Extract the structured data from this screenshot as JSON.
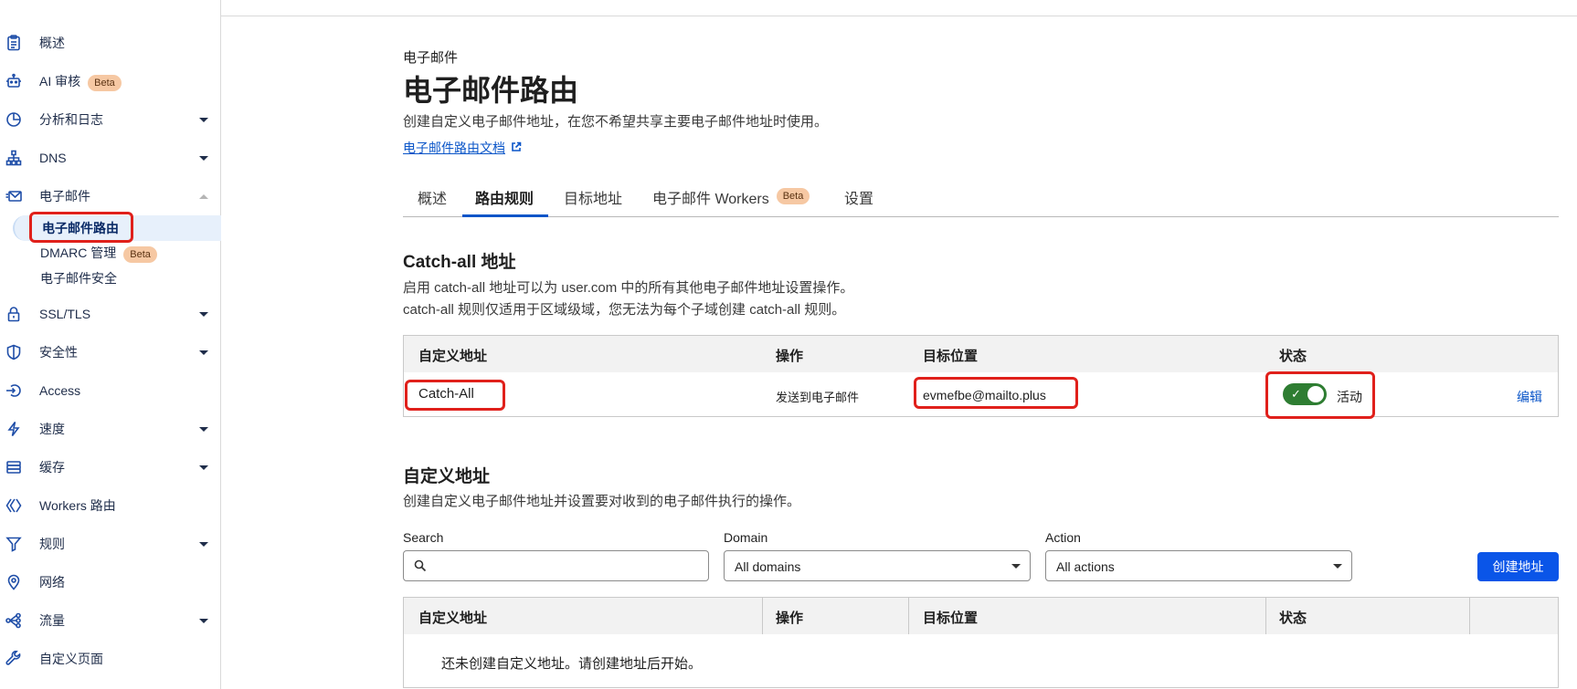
{
  "sidebar": {
    "items": [
      {
        "label": "概述",
        "icon": "clipboard-icon",
        "caret": "none"
      },
      {
        "label": "AI 审核",
        "icon": "robot-icon",
        "caret": "none",
        "badge": "Beta"
      },
      {
        "label": "分析和日志",
        "icon": "chart-pie-icon",
        "caret": "down"
      },
      {
        "label": "DNS",
        "icon": "network-tree-icon",
        "caret": "down"
      },
      {
        "label": "电子邮件",
        "icon": "mail-icon",
        "caret": "up"
      },
      {
        "label": "SSL/TLS",
        "icon": "lock-icon",
        "caret": "down"
      },
      {
        "label": "安全性",
        "icon": "shield-icon",
        "caret": "down"
      },
      {
        "label": "Access",
        "icon": "access-login-icon",
        "caret": "none"
      },
      {
        "label": "速度",
        "icon": "bolt-icon",
        "caret": "down"
      },
      {
        "label": "缓存",
        "icon": "server-stack-icon",
        "caret": "down"
      },
      {
        "label": "Workers 路由",
        "icon": "workers-icon",
        "caret": "none"
      },
      {
        "label": "规则",
        "icon": "funnel-icon",
        "caret": "down"
      },
      {
        "label": "网络",
        "icon": "location-pin-icon",
        "caret": "none"
      },
      {
        "label": "流量",
        "icon": "traffic-nodes-icon",
        "caret": "down"
      },
      {
        "label": "自定义页面",
        "icon": "wrench-icon",
        "caret": "none"
      }
    ],
    "email_sub": [
      {
        "label": "电子邮件路由",
        "active": true
      },
      {
        "label": "DMARC 管理",
        "badge": "Beta"
      },
      {
        "label": "电子邮件安全"
      }
    ]
  },
  "header": {
    "eyebrow": "电子邮件",
    "title": "电子邮件路由",
    "description": "创建自定义电子邮件地址，在您不希望共享主要电子邮件地址时使用。",
    "doc_link": "电子邮件路由文档"
  },
  "tabs": [
    {
      "label": "概述"
    },
    {
      "label": "路由规则",
      "active": true
    },
    {
      "label": "目标地址"
    },
    {
      "label": "电子邮件 Workers",
      "badge": "Beta"
    },
    {
      "label": "设置"
    }
  ],
  "catch_all": {
    "title": "Catch-all 地址",
    "desc_line1": "启用 catch-all 地址可以为 user.com 中的所有其他电子邮件地址设置操作。",
    "desc_line2": "catch-all 规则仅适用于区域级域，您无法为每个子域创建 catch-all 规则。",
    "columns": [
      "自定义地址",
      "操作",
      "目标位置",
      "状态"
    ],
    "row": {
      "address": "Catch-All",
      "action": "发送到电子邮件",
      "destination": "evmefbe@mailto.plus",
      "status": "活动",
      "enabled": true,
      "edit": "编辑"
    }
  },
  "custom": {
    "title": "自定义地址",
    "desc": "创建自定义电子邮件地址并设置要对收到的电子邮件执行的操作。",
    "filters": {
      "search_label": "Search",
      "search_value": "",
      "domain_label": "Domain",
      "domain_value": "All domains",
      "action_label": "Action",
      "action_value": "All actions"
    },
    "create_button": "创建地址",
    "columns": [
      "自定义地址",
      "操作",
      "目标位置",
      "状态"
    ],
    "empty_text": "还未创建自定义地址。请创建地址后开始。"
  },
  "colors": {
    "accent": "#0a55e8",
    "highlight": "#e0201b",
    "toggle_on": "#2e7d32",
    "beta_badge": "#f6c8a3"
  }
}
